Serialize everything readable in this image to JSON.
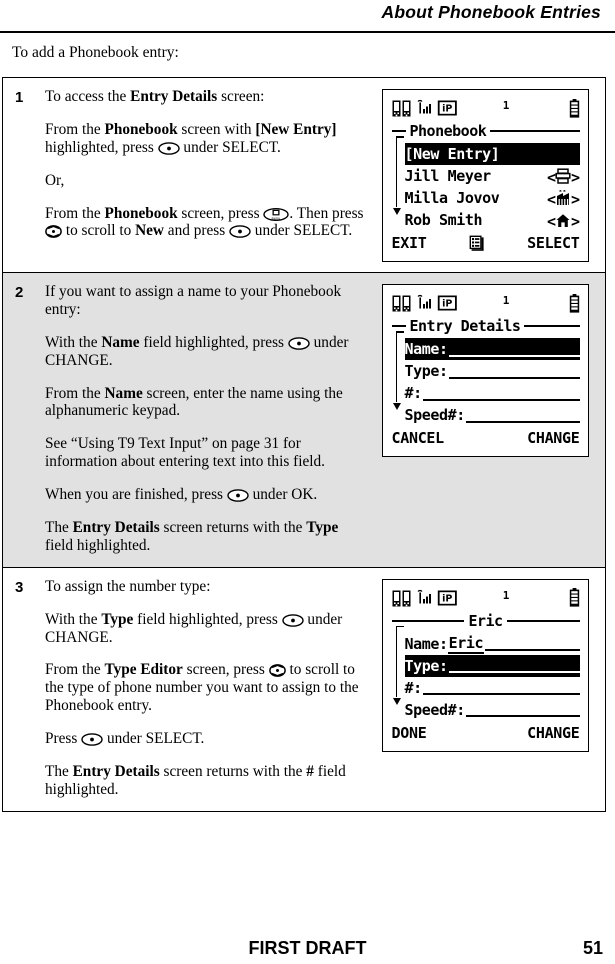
{
  "header": {
    "running_head": "About Phonebook Entries"
  },
  "intro": "To add a Phonebook entry:",
  "footer": {
    "draft_label": "FIRST DRAFT",
    "page_number": "51"
  },
  "steps": [
    {
      "number": "1",
      "paragraphs": [
        {
          "parts": [
            {
              "t": "To access the "
            },
            {
              "t": "Entry Details",
              "b": true
            },
            {
              "t": " screen:"
            }
          ]
        },
        {
          "parts": [
            {
              "t": "From the "
            },
            {
              "t": "Phonebook",
              "b": true
            },
            {
              "t": " screen with "
            },
            {
              "t": "[New Entry]",
              "b": true
            },
            {
              "t": " highlighted, press "
            },
            {
              "icon": "select-key-icon"
            },
            {
              "t": " under SELECT."
            }
          ]
        },
        {
          "parts": [
            {
              "t": "Or,"
            }
          ]
        },
        {
          "parts": [
            {
              "t": "From the "
            },
            {
              "t": "Phonebook",
              "b": true
            },
            {
              "t": " screen, press "
            },
            {
              "icon": "menu-key-icon"
            },
            {
              "t": ". Then press "
            },
            {
              "icon": "scroll-key-icon"
            },
            {
              "t": " to scroll to "
            },
            {
              "t": "New",
              "b": true
            },
            {
              "t": " and press "
            },
            {
              "icon": "select-key-icon"
            },
            {
              "t": " under SELECT."
            }
          ]
        }
      ],
      "screen": "phonebook"
    },
    {
      "number": "2",
      "shaded": true,
      "paragraphs": [
        {
          "parts": [
            {
              "t": "If you want to assign a name to your Phonebook entry:"
            }
          ]
        },
        {
          "parts": [
            {
              "t": "With the "
            },
            {
              "t": "Name",
              "b": true
            },
            {
              "t": " field highlighted, press "
            },
            {
              "icon": "select-key-icon"
            },
            {
              "t": " under CHANGE."
            }
          ]
        },
        {
          "parts": [
            {
              "t": "From the "
            },
            {
              "t": "Name",
              "b": true
            },
            {
              "t": " screen, enter the name using the alphanumeric keypad."
            }
          ]
        },
        {
          "parts": [
            {
              "t": "See “Using T9 Text Input” on page 31 for information about entering text into this field."
            }
          ]
        },
        {
          "parts": [
            {
              "t": "When you are finished, press "
            },
            {
              "icon": "select-key-icon"
            },
            {
              "t": " under OK."
            }
          ]
        },
        {
          "parts": [
            {
              "t": "The "
            },
            {
              "t": "Entry Details",
              "b": true
            },
            {
              "t": " screen returns with the "
            },
            {
              "t": "Type",
              "b": true
            },
            {
              "t": " field highlighted."
            }
          ]
        }
      ],
      "screen": "entry_details"
    },
    {
      "number": "3",
      "paragraphs": [
        {
          "parts": [
            {
              "t": "To assign the number type:"
            }
          ]
        },
        {
          "parts": [
            {
              "t": "With the "
            },
            {
              "t": "Type",
              "b": true
            },
            {
              "t": " field highlighted, press "
            },
            {
              "icon": "select-key-icon"
            },
            {
              "t": " under CHANGE."
            }
          ]
        },
        {
          "parts": [
            {
              "t": "From the "
            },
            {
              "t": "Type Editor",
              "b": true
            },
            {
              "t": " screen, press "
            },
            {
              "icon": "scroll-key-icon"
            },
            {
              "t": " to scroll to the type of phone number you want to assign to the Phonebook entry."
            }
          ]
        },
        {
          "parts": [
            {
              "t": "Press "
            },
            {
              "icon": "select-key-icon"
            },
            {
              "t": " under SELECT."
            }
          ]
        },
        {
          "parts": [
            {
              "t": "The "
            },
            {
              "t": "Entry Details",
              "b": true
            },
            {
              "t": " screen returns with the "
            },
            {
              "t": "#",
              "b": true
            },
            {
              "t": " field highlighted."
            }
          ]
        }
      ],
      "screen": "eric"
    }
  ],
  "screens": {
    "phonebook": {
      "status": {
        "icons": [
          "phonebook-icon",
          "signal-strength-icon",
          "ip-mode-icon"
        ],
        "indicator": "1",
        "battery": "battery-icon"
      },
      "title": "Phonebook",
      "rows": [
        {
          "label": "[New Entry]",
          "highlighted": true,
          "type_icon": ""
        },
        {
          "label": "Jill Meyer",
          "highlighted": false,
          "type_icon": "fax-icon"
        },
        {
          "label": "Milla Jovov",
          "highlighted": false,
          "type_icon": "work-icon"
        },
        {
          "label": "Rob Smith",
          "highlighted": false,
          "type_icon": "home-icon"
        }
      ],
      "softkeys": {
        "left": "EXIT",
        "center": "menu-icon",
        "right": "SELECT"
      }
    },
    "entry_details": {
      "status": {
        "icons": [
          "phonebook-icon",
          "signal-strength-icon",
          "ip-mode-icon"
        ],
        "indicator": "1",
        "battery": "battery-icon"
      },
      "title": "Entry Details",
      "fields": [
        {
          "label": "Name:",
          "value": "",
          "highlighted": true
        },
        {
          "label": "Type:",
          "value": "",
          "highlighted": false
        },
        {
          "label": "#:",
          "value": "",
          "highlighted": false
        },
        {
          "label": "Speed#:",
          "value": "",
          "highlighted": false
        }
      ],
      "softkeys": {
        "left": "CANCEL",
        "center": "",
        "right": "CHANGE"
      }
    },
    "eric": {
      "status": {
        "icons": [
          "phonebook-icon",
          "signal-strength-icon",
          "ip-mode-icon"
        ],
        "indicator": "1",
        "battery": "battery-icon"
      },
      "title": "Eric",
      "fields": [
        {
          "label": "Name:",
          "value": "Eric",
          "highlighted": false
        },
        {
          "label": "Type:",
          "value": "",
          "highlighted": true
        },
        {
          "label": "#:",
          "value": "",
          "highlighted": false
        },
        {
          "label": "Speed#:",
          "value": "",
          "highlighted": false
        }
      ],
      "softkeys": {
        "left": "DONE",
        "center": "",
        "right": "CHANGE"
      }
    }
  }
}
